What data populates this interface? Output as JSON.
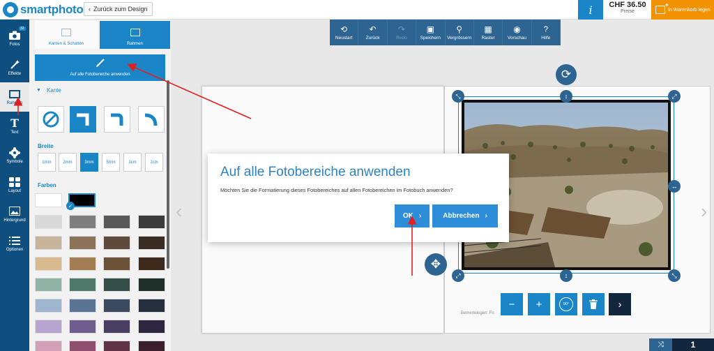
{
  "header": {
    "logo_text": "smartphoto",
    "back_label": "Zurück zum Design",
    "info_symbol": "i",
    "price": "CHF 36.50",
    "price_label": "Preise",
    "cart_label": "In Warenkorb legen"
  },
  "rail": {
    "items": [
      {
        "label": "Fotos",
        "icon": "camera-icon",
        "badge": "32"
      },
      {
        "label": "Effekte",
        "icon": "magic-wand-icon"
      },
      {
        "label": "Rahmen",
        "icon": "frame-icon"
      },
      {
        "label": "Text",
        "icon": "text-icon"
      },
      {
        "label": "Symbole",
        "icon": "gear-icon"
      },
      {
        "label": "Layout",
        "icon": "layout-icon"
      },
      {
        "label": "Hintergrund",
        "icon": "image-icon"
      },
      {
        "label": "Optionen",
        "icon": "list-icon"
      }
    ]
  },
  "panel": {
    "tab_kanten": "Kanten & Schatten",
    "tab_rahmen": "Rahmen",
    "apply_all": "Auf alle Fotobereiche anwenden",
    "kante_heading": "Kante",
    "breite_heading": "Breite",
    "widths": [
      "1mm",
      "2mm",
      "3mm",
      "5mm",
      "1cm",
      "2cm"
    ],
    "selected_width": "3mm",
    "farben_heading": "Farben",
    "colors": [
      "#ffffff",
      "#000000",
      "#d9d9d9",
      "#7f7f7f",
      "#595959",
      "#3b3b3b",
      "#c8b49a",
      "#8c7258",
      "#5d4a3b",
      "#3a2d24",
      "#d9ba8c",
      "#a17d51",
      "#6b5136",
      "#3e2a1a",
      "#8fb3a5",
      "#4f7a6b",
      "#344f47",
      "#1f302b",
      "#9fb6d0",
      "#5a7493",
      "#3a4a60",
      "#262f3d",
      "#b7a5cf",
      "#6f5d8d",
      "#4a3d63",
      "#2e2540",
      "#d2a1b8",
      "#8f4f6f",
      "#603347",
      "#3b1f2c"
    ]
  },
  "toolbar": {
    "items": [
      {
        "label": "Neustart",
        "glyph": "⟲",
        "icon": "restart-icon",
        "disabled": false
      },
      {
        "label": "Zurück",
        "glyph": "↶",
        "icon": "undo-icon",
        "disabled": false
      },
      {
        "label": "Redo",
        "glyph": "↷",
        "icon": "redo-icon",
        "disabled": true
      },
      {
        "label": "Speichern",
        "glyph": "▣",
        "icon": "save-icon",
        "disabled": false
      },
      {
        "label": "Vergrössern",
        "glyph": "⚲",
        "icon": "zoom-icon",
        "disabled": false
      },
      {
        "label": "Raster",
        "glyph": "▦",
        "icon": "grid-icon",
        "disabled": false
      },
      {
        "label": "Vorschau",
        "glyph": "◉",
        "icon": "eye-icon",
        "disabled": false
      },
      {
        "label": "Hilfe",
        "glyph": "?",
        "icon": "help-icon",
        "disabled": false
      }
    ]
  },
  "photo_controls": {
    "minus": "−",
    "plus": "+",
    "rotate_label": "90°",
    "next": "›"
  },
  "caption": "Bemerkungen: Fo",
  "bottom": {
    "shuffle": "⤨",
    "page_number": "1"
  },
  "modal": {
    "title": "Auf alle Fotobereiche anwenden",
    "text": "Möchten Sie die Formatierung dieses Fotobereiches auf allen Fotobereichen im Fotobuch anwenden?",
    "ok_label": "OK",
    "cancel_label": "Abbrechen"
  }
}
